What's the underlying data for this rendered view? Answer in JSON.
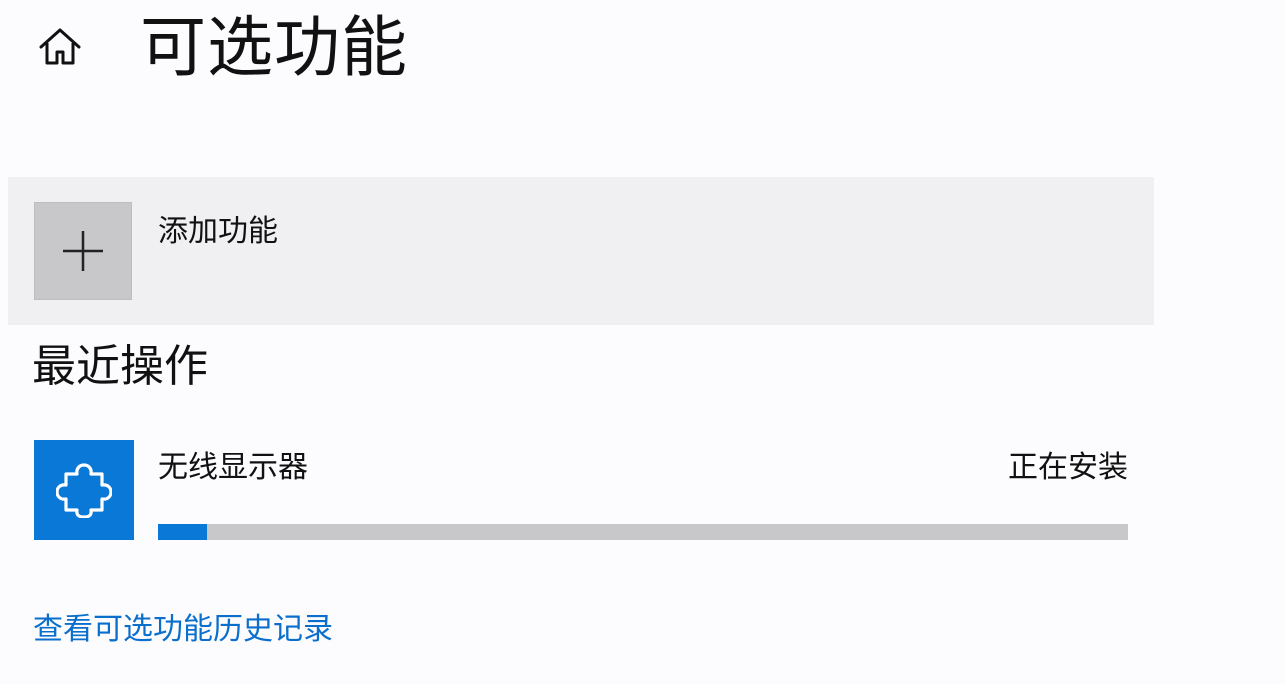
{
  "header": {
    "home_icon": "home-icon",
    "title": "可选功能"
  },
  "add_feature": {
    "icon": "plus-icon",
    "label": "添加功能"
  },
  "recent": {
    "title": "最近操作",
    "items": [
      {
        "icon": "puzzle-piece-icon",
        "name": "无线显示器",
        "status": "正在安装",
        "progress_fraction": 0.05
      }
    ]
  },
  "footer": {
    "history_link": "查看可选功能历史记录"
  },
  "colors": {
    "accent": "#0a78d7",
    "link": "#0a6fcc",
    "background": "#fcfbfd",
    "tile_gray": "#c8c7c9",
    "row_bg": "#f0eff1"
  }
}
